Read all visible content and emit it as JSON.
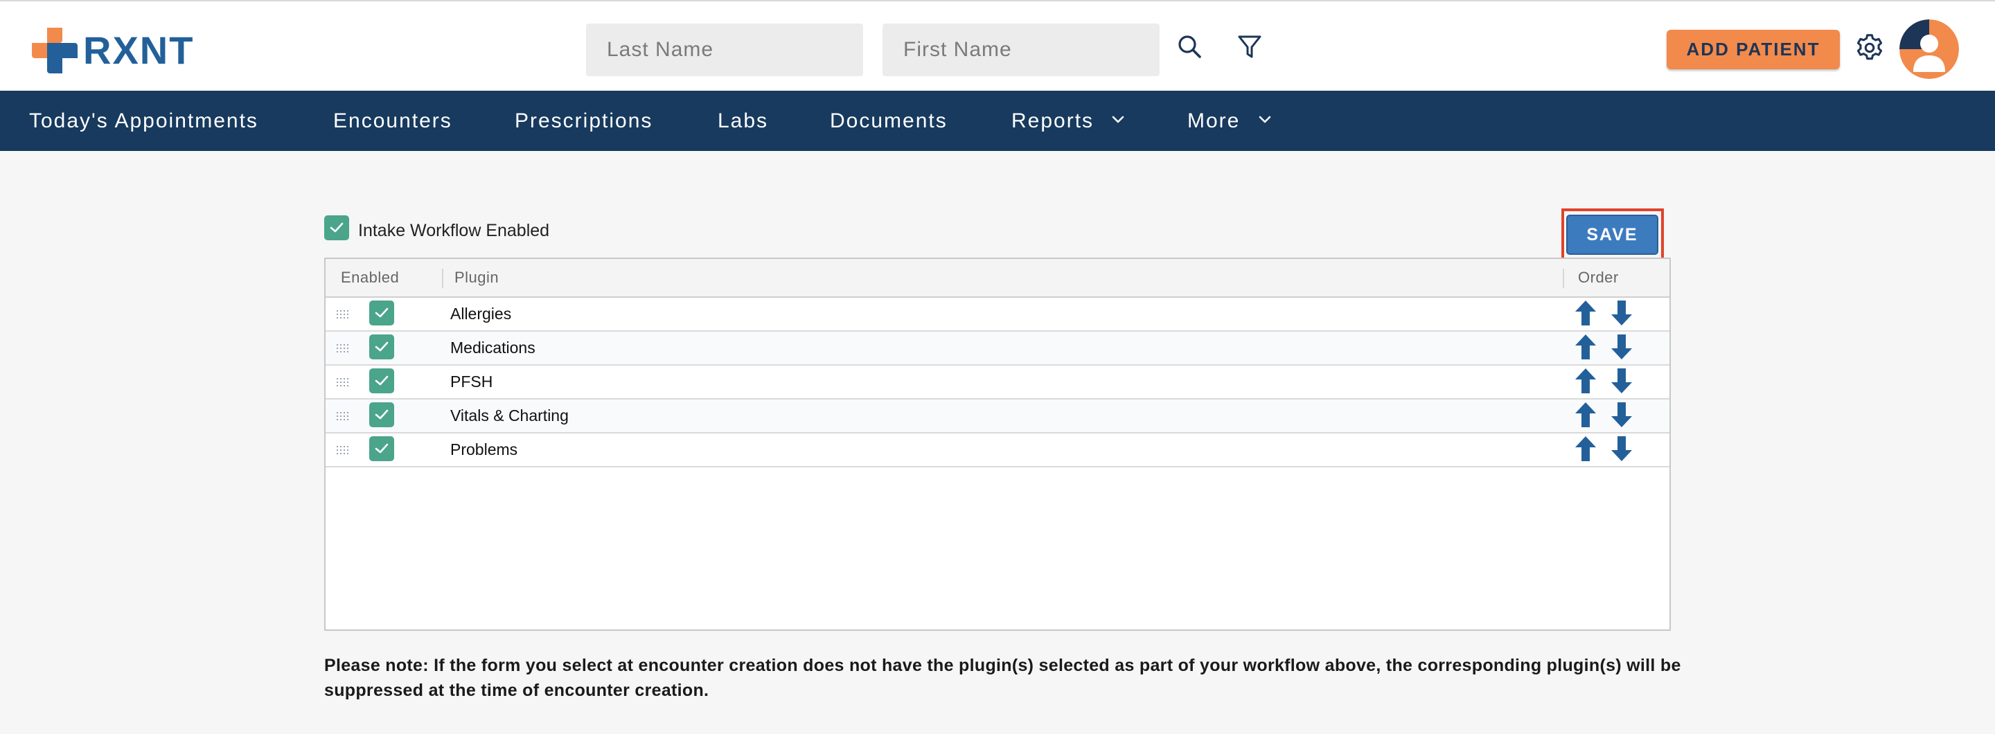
{
  "app": {
    "brand": "RXNT",
    "colors": {
      "brand_blue": "#23609a",
      "brand_orange": "#f28a4c",
      "nav_bg": "#173a5e",
      "check_green": "#4aa58a",
      "arrow_blue": "#23609a",
      "save_blue": "#3d7bbf",
      "highlight_red": "#e0432c"
    }
  },
  "header": {
    "last_name_placeholder": "Last Name",
    "first_name_placeholder": "First Name",
    "search_icon": "search-icon",
    "filter_icon": "filter-icon",
    "add_patient_label": "ADD PATIENT",
    "settings_icon": "gear-icon",
    "avatar_icon": "user-avatar"
  },
  "nav": {
    "items": [
      {
        "label": "Today's Appointments",
        "dropdown": false
      },
      {
        "label": "Encounters",
        "dropdown": false
      },
      {
        "label": "Prescriptions",
        "dropdown": false
      },
      {
        "label": "Labs",
        "dropdown": false
      },
      {
        "label": "Documents",
        "dropdown": false
      },
      {
        "label": "Reports",
        "dropdown": true
      },
      {
        "label": "More",
        "dropdown": true
      }
    ]
  },
  "main": {
    "intake_workflow": {
      "label": "Intake Workflow Enabled",
      "checked": true
    },
    "save_label": "SAVE",
    "table": {
      "columns": {
        "enabled": "Enabled",
        "plugin": "Plugin",
        "order": "Order"
      },
      "rows": [
        {
          "label": "Allergies",
          "enabled": true
        },
        {
          "label": "Medications",
          "enabled": true
        },
        {
          "label": "PFSH",
          "enabled": true
        },
        {
          "label": "Vitals & Charting",
          "enabled": true
        },
        {
          "label": "Problems",
          "enabled": true
        }
      ]
    },
    "note": "Please note: If the form you select at encounter creation does not have the plugin(s) selected as part of your workflow above, the corresponding plugin(s) will be suppressed at the time of encounter creation."
  }
}
